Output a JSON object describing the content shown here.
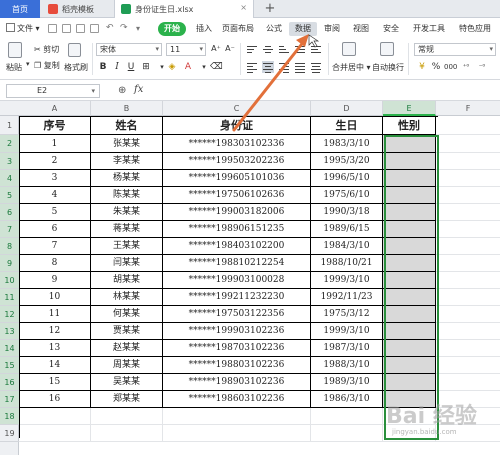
{
  "tabs": {
    "home": "首页",
    "template": "稻壳模板",
    "file": "身份证生日.xlsx",
    "close": "×",
    "add": "+"
  },
  "menu": {
    "file": "文件",
    "start": "开始",
    "insert": "插入",
    "layout": "页面布局",
    "formula": "公式",
    "data": "数据",
    "review": "审阅",
    "view": "视图",
    "security": "安全",
    "developer": "开发工具",
    "special": "特色应用"
  },
  "ribbon": {
    "cut": "剪切",
    "copy": "复制",
    "paste": "粘贴",
    "format_painter": "格式刷",
    "font_name": "宋体",
    "font_size": "11",
    "merge_center": "合并居中",
    "wrap_text": "自动换行",
    "number_format": "常规"
  },
  "formula_bar": {
    "cell_ref": "E2",
    "fx": "fx",
    "zoom": "⊕"
  },
  "columns": [
    "A",
    "B",
    "C",
    "D",
    "E",
    "F"
  ],
  "rows": [
    "1",
    "2",
    "3",
    "4",
    "5",
    "6",
    "7",
    "8",
    "9",
    "10",
    "11",
    "12",
    "13",
    "14",
    "15",
    "16",
    "17",
    "18",
    "19"
  ],
  "table": {
    "headers": [
      "序号",
      "姓名",
      "身份证",
      "生日",
      "性别"
    ],
    "records": [
      [
        "1",
        "张某某",
        "******198303102336",
        "1983/3/10"
      ],
      [
        "2",
        "李某某",
        "******199503202236",
        "1995/3/20"
      ],
      [
        "3",
        "杨某某",
        "******199605101036",
        "1996/5/10"
      ],
      [
        "4",
        "陈某某",
        "******197506102636",
        "1975/6/10"
      ],
      [
        "5",
        "朱某某",
        "******199003182006",
        "1990/3/18"
      ],
      [
        "6",
        "蒋某某",
        "******198906151235",
        "1989/6/15"
      ],
      [
        "7",
        "王某某",
        "******198403102200",
        "1984/3/10"
      ],
      [
        "8",
        "闫某某",
        "******198810212254",
        "1988/10/21"
      ],
      [
        "9",
        "胡某某",
        "******199903100028",
        "1999/3/10"
      ],
      [
        "10",
        "林某某",
        "******199211232230",
        "1992/11/23"
      ],
      [
        "11",
        "何某某",
        "******197503122356",
        "1975/3/12"
      ],
      [
        "12",
        "贾某某",
        "******199903102236",
        "1999/3/10"
      ],
      [
        "13",
        "赵某某",
        "******198703102236",
        "1987/3/10"
      ],
      [
        "14",
        "周某某",
        "******198803102236",
        "1988/3/10"
      ],
      [
        "15",
        "吴某某",
        "******198903102236",
        "1989/3/10"
      ],
      [
        "16",
        "郑某某",
        "******198603102236",
        "1986/3/10"
      ]
    ]
  },
  "watermark": {
    "logo": "Bai 经验",
    "url": "jingyan.baidu.com"
  },
  "colors": {
    "accent_green": "#2bb24c",
    "selection_border": "#2a8f3c",
    "arrow": "#e2703a",
    "gender_fill": "#d9d9d9",
    "home_tab": "#3a6fd8"
  }
}
